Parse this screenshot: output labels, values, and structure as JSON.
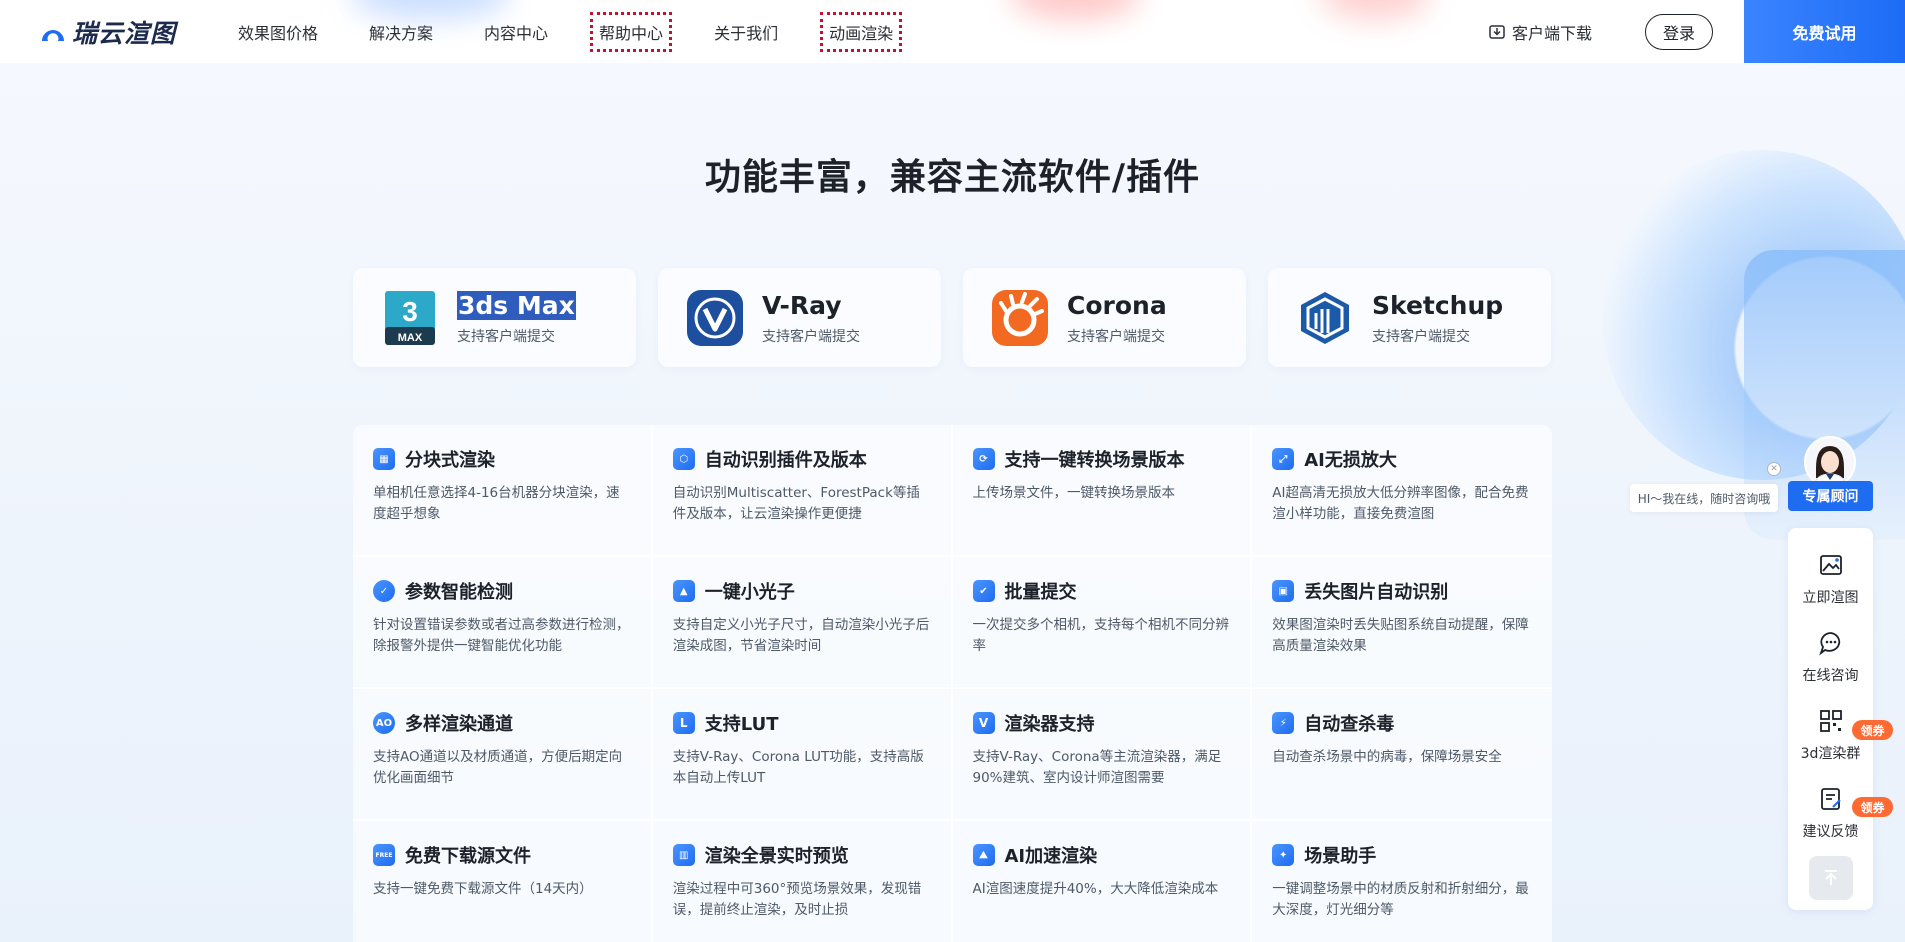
{
  "header": {
    "logo_text": "瑞云渲图",
    "nav": [
      {
        "label": "效果图价格",
        "boxed": false
      },
      {
        "label": "解决方案",
        "boxed": false
      },
      {
        "label": "内容中心",
        "boxed": false
      },
      {
        "label": "帮助中心",
        "boxed": true
      },
      {
        "label": "关于我们",
        "boxed": false
      },
      {
        "label": "动画渲染",
        "boxed": true
      }
    ],
    "download_label": "客户端下载",
    "login_label": "登录",
    "trial_label": "免费试用"
  },
  "section_title": "功能丰富，兼容主流软件/插件",
  "software": [
    {
      "name": "3ds Max",
      "sub": "支持客户端提交",
      "icon": "3dsmax-icon",
      "selected": true
    },
    {
      "name": "V-Ray",
      "sub": "支持客户端提交",
      "icon": "vray-icon",
      "selected": false
    },
    {
      "name": "Corona",
      "sub": "支持客户端提交",
      "icon": "corona-icon",
      "selected": false
    },
    {
      "name": "Sketchup",
      "sub": "支持客户端提交",
      "icon": "sketchup-icon",
      "selected": false
    }
  ],
  "features": [
    {
      "title": "分块式渲染",
      "desc": "单相机任意选择4-16台机器分块渲染，速度超乎想象",
      "icon": "split-render-icon"
    },
    {
      "title": "自动识别插件及版本",
      "desc": "自动识别Multiscatter、ForestPack等插件及版本，让云渲染操作更便捷",
      "icon": "plugin-detect-icon"
    },
    {
      "title": "支持一键转换场景版本",
      "desc": "上传场景文件，一键转换场景版本",
      "icon": "convert-version-icon"
    },
    {
      "title": "AI无损放大",
      "desc": "AI超高清无损放大低分辨率图像，配合免费渲小样功能，直接免费渲图",
      "icon": "ai-upscale-icon"
    },
    {
      "title": "参数智能检测",
      "desc": "针对设置错误参数或者过高参数进行检测，除报警外提供一键智能优化功能",
      "icon": "param-check-icon"
    },
    {
      "title": "一键小光子",
      "desc": "支持自定义小光子尺寸，自动渲染小光子后渲染成图，节省渲染时间",
      "icon": "photon-icon"
    },
    {
      "title": "批量提交",
      "desc": "一次提交多个相机，支持每个相机不同分辨率",
      "icon": "batch-submit-icon"
    },
    {
      "title": "丢失图片自动识别",
      "desc": "效果图渲染时丢失贴图系统自动提醒，保障高质量渲染效果",
      "icon": "missing-image-icon"
    },
    {
      "title": "多样渲染通道",
      "desc": "支持AO通道以及材质通道，方便后期定向优化画面细节",
      "icon": "ao-channel-icon",
      "glyph": "AO"
    },
    {
      "title": "支持LUT",
      "desc": "支持V-Ray、Corona LUT功能，支持高版本自动上传LUT",
      "icon": "lut-icon",
      "glyph": "L"
    },
    {
      "title": "渲染器支持",
      "desc": "支持V-Ray、Corona等主流渲染器，满足90%建筑、室内设计师渲图需要",
      "icon": "renderer-icon",
      "glyph": "V"
    },
    {
      "title": "自动查杀毒",
      "desc": "自动查杀场景中的病毒，保障场景安全",
      "icon": "antivirus-icon"
    },
    {
      "title": "免费下载源文件",
      "desc": "支持一键免费下载源文件（14天内）",
      "icon": "free-download-icon",
      "glyph": "FREE"
    },
    {
      "title": "渲染全景实时预览",
      "desc": "渲染过程中可360°预览场景效果，发现错误，提前终止渲染，及时止损",
      "icon": "panorama-preview-icon"
    },
    {
      "title": "AI加速渲染",
      "desc": "AI渲图速度提升40%，大大降低渲染成本",
      "icon": "ai-accelerate-icon"
    },
    {
      "title": "场景助手",
      "desc": "一键调整场景中的材质反射和折射细分，最大深度，灯光细分等",
      "icon": "scene-assistant-icon"
    }
  ],
  "consult": {
    "bubble_text": "HI～我在线，随时咨询哦",
    "button_label": "专属顾问"
  },
  "side_tools": [
    {
      "label": "立即渲图",
      "icon": "image-icon",
      "badge": ""
    },
    {
      "label": "在线咨询",
      "icon": "chat-icon",
      "badge": ""
    },
    {
      "label": "3d渲染群",
      "icon": "qrcode-icon",
      "badge": "领券"
    },
    {
      "label": "建议反馈",
      "icon": "feedback-icon",
      "badge": "领券"
    }
  ],
  "colors": {
    "accent": "#1e6cf0",
    "coupon": "#ff6a33",
    "selection": "#2e5dbd",
    "nav_box": "#c8102e"
  }
}
